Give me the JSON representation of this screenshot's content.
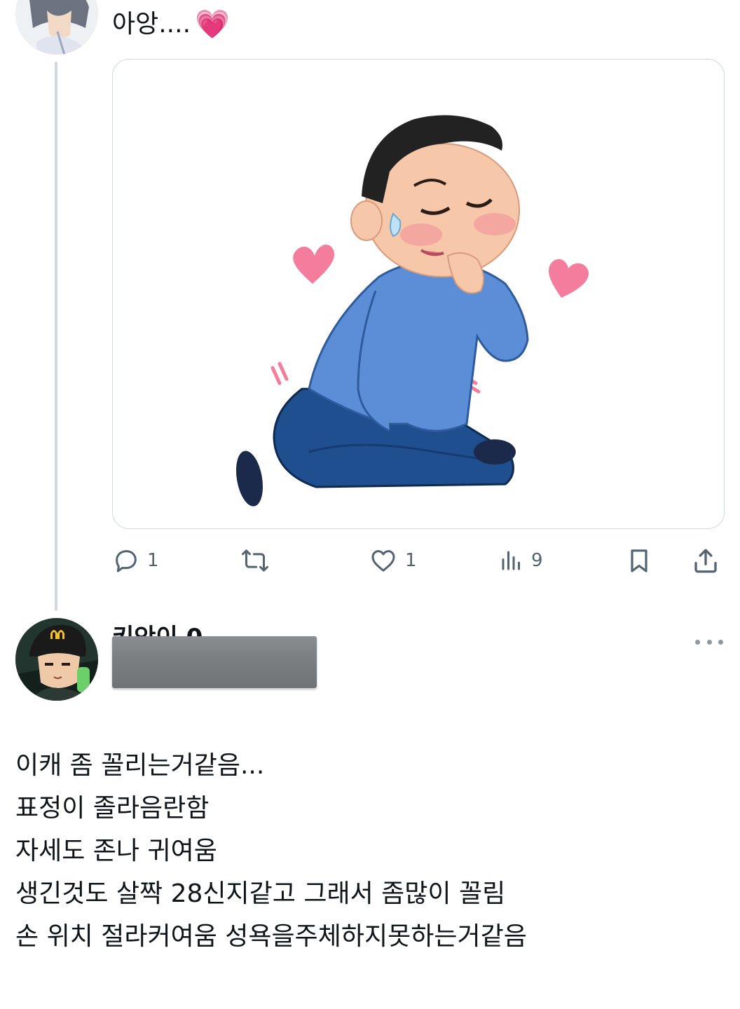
{
  "tweet1": {
    "text": "아앙....",
    "emoji": "💗",
    "image_alt": "blushing kneeling man illustration",
    "stats": {
      "replies": "1",
      "retweets": "",
      "likes": "1",
      "views": "9"
    }
  },
  "tweet2": {
    "name_partial": "키안이 0",
    "more_label": "···",
    "lines": [
      "이캐 좀 꼴리는거같음...",
      "표정이 졸라음란함",
      "자세도 존나 귀여움",
      "생긴것도 살짝 28신지같고 그래서 좀많이 꼴림",
      "손 위치 절라커여움 성욕을주체하지못하는거같음"
    ]
  },
  "colors": {
    "line": "#cfd9de",
    "icon": "#536471",
    "heart": "#f47c9c",
    "shirt": "#5b8ed6",
    "pants": "#1f4f8f"
  }
}
